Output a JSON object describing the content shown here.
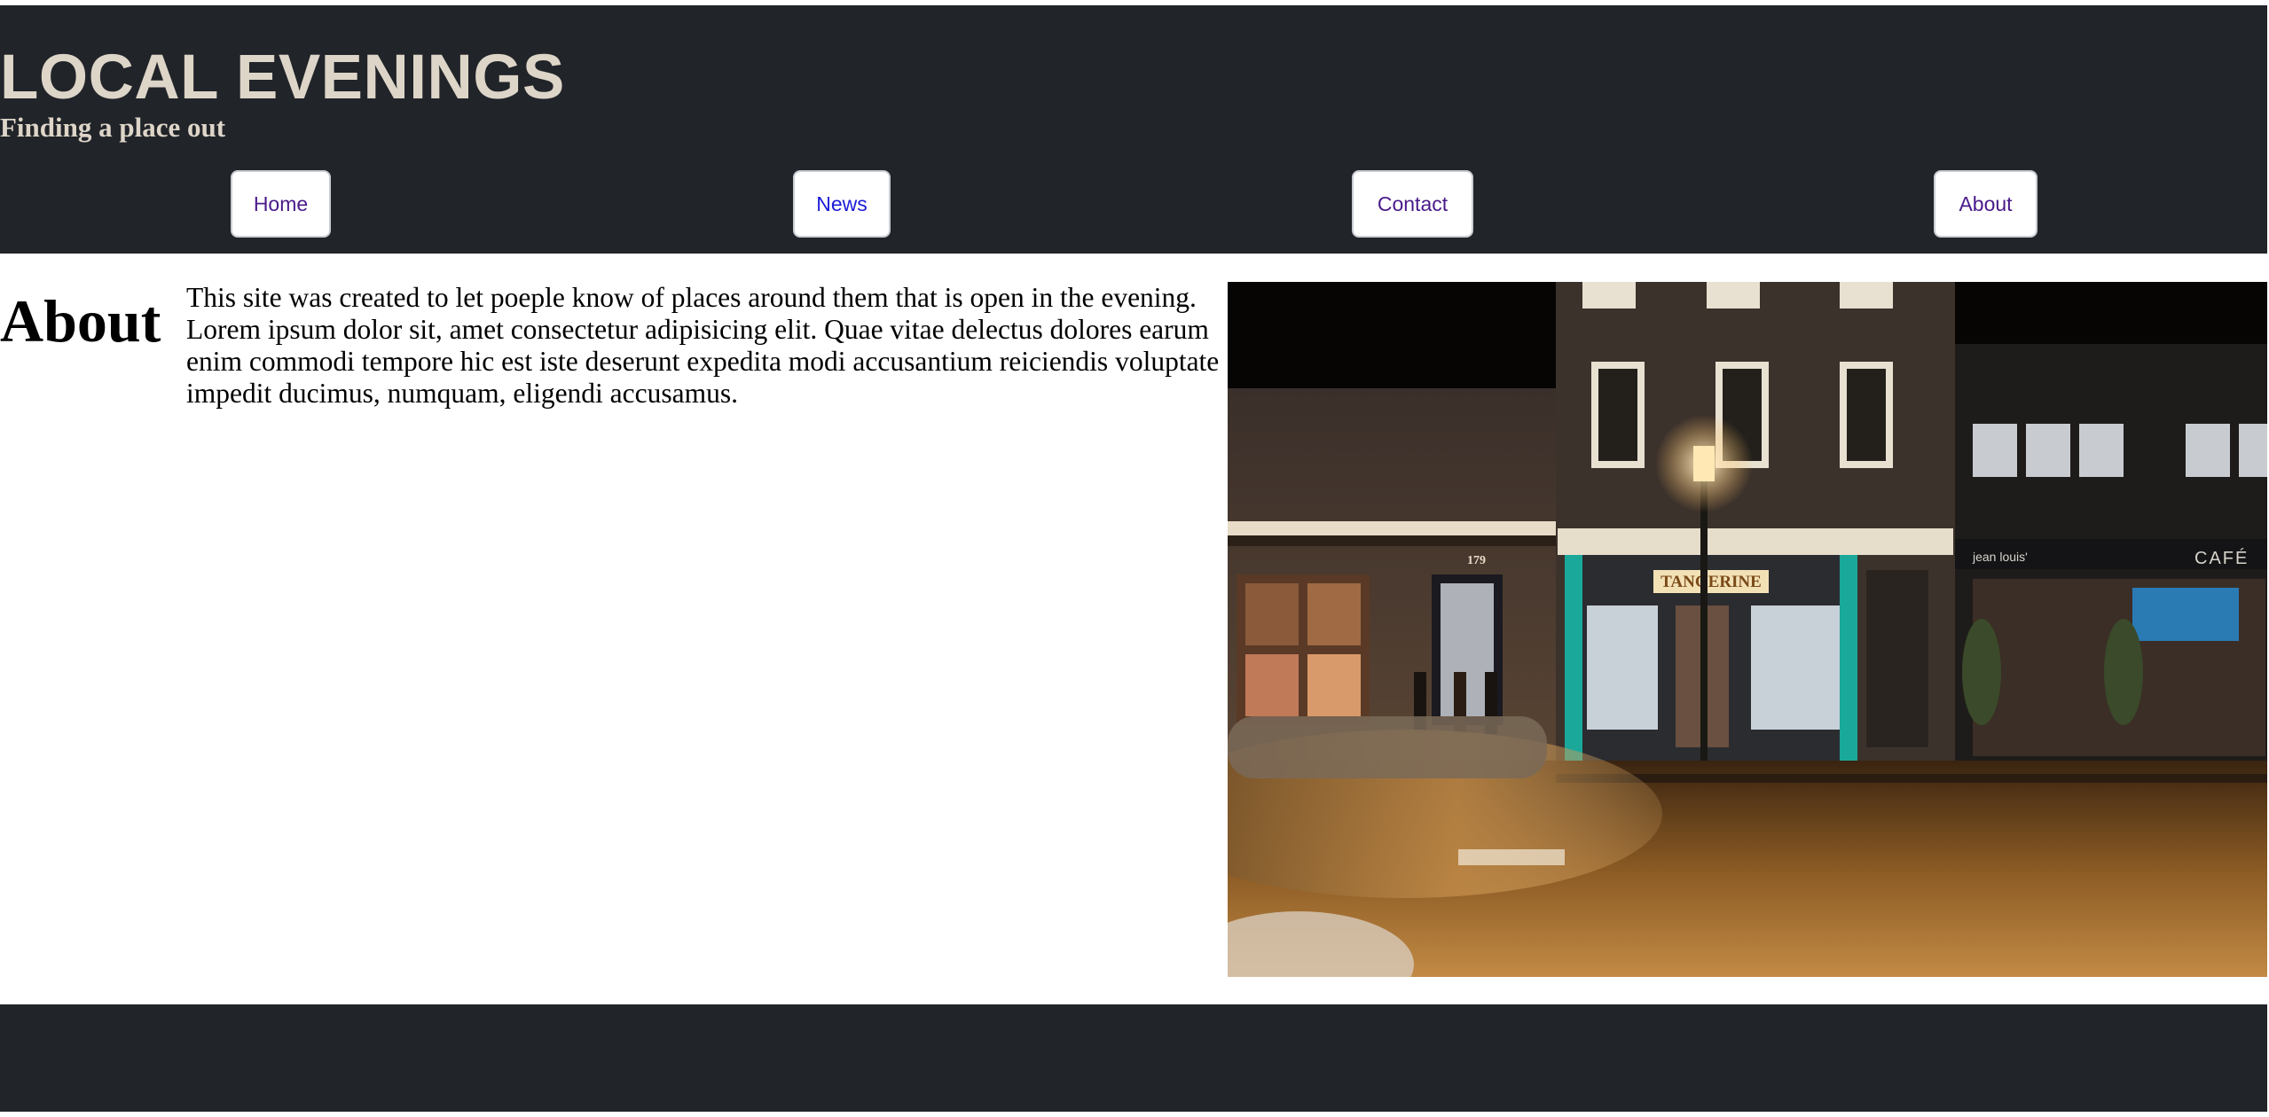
{
  "header": {
    "title": "LOCAL EVENINGS",
    "subtitle": "Finding a place out"
  },
  "nav": {
    "home": "Home",
    "news": "News",
    "contact": "Contact",
    "about": "About"
  },
  "main": {
    "heading": "About",
    "text": "This site was created to let poeple know of places around them that is open in the evening. Lorem ipsum dolor sit, amet consectetur adipisicing elit. Quae vitae delectus dolores earum enim commodi tempore hic est iste deserunt expedita modi accusantium reiciendis voluptate impedit ducimus, numquam, eligendi accusamus.",
    "photo": {
      "store_left_number": "179",
      "store_sign": "TANGERINE",
      "store_right_sign": "jean louis'",
      "cafe_sign": "CAFÉ"
    }
  },
  "colors": {
    "header_bg": "#212429",
    "title_color": "#ddd5c8",
    "link_visited": "#4a1a8a",
    "link": "#1b1bd8"
  }
}
